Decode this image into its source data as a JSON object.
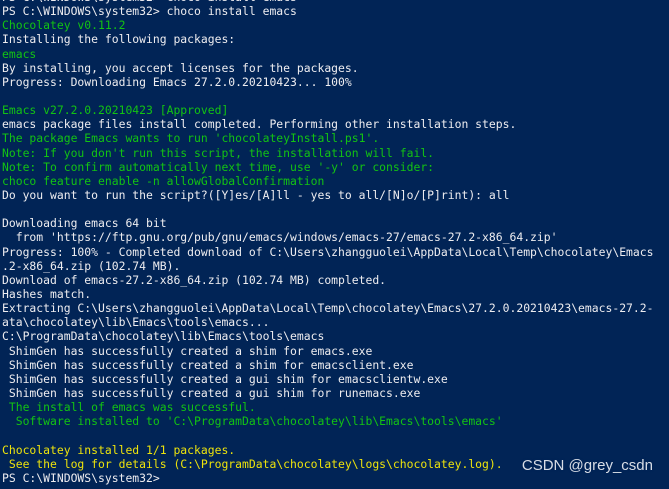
{
  "colors": {
    "background": "#012456",
    "default": "#eeedf0",
    "green": "#13c313",
    "yellow": "#ede30c",
    "highlight": "#f2f5ee"
  },
  "terminal": {
    "lines": [
      {
        "text": "PS C:\\WINDOWS\\system32> choco install emacs",
        "color": "default"
      },
      {
        "text": "PS C:\\WINDOWS\\system32> choco install emacs",
        "color": "default"
      },
      {
        "text": "Chocolatey v0.11.2",
        "color": "green"
      },
      {
        "text": "Installing the following packages:",
        "color": "default"
      },
      {
        "text": "emacs",
        "color": "green"
      },
      {
        "text": "By installing, you accept licenses for the packages.",
        "color": "default"
      },
      {
        "text": "Progress: Downloading Emacs 27.2.0.20210423... 100%",
        "color": "default"
      },
      {
        "text": "",
        "color": "default"
      },
      {
        "text": "Emacs v27.2.0.20210423 [Approved]",
        "color": "green"
      },
      {
        "text": "emacs package files install completed. Performing other installation steps.",
        "color": "default"
      },
      {
        "text": "The package Emacs wants to run 'chocolateyInstall.ps1'.",
        "color": "green"
      },
      {
        "text": "Note: If you don't run this script, the installation will fail.",
        "color": "green"
      },
      {
        "text": "Note: To confirm automatically next time, use '-y' or consider:",
        "color": "green"
      },
      {
        "text": "choco feature enable -n allowGlobalConfirmation",
        "color": "green"
      },
      {
        "text": "Do you want to run the script?([Y]es/[A]ll - yes to all/[N]o/[P]rint): all",
        "color": "default"
      },
      {
        "text": "",
        "color": "default"
      },
      {
        "text": "Downloading emacs 64 bit",
        "color": "default"
      },
      {
        "text": "  from 'https://ftp.gnu.org/pub/gnu/emacs/windows/emacs-27/emacs-27.2-x86_64.zip'",
        "color": "default"
      },
      {
        "text": "Progress: 100% - Completed download of C:\\Users\\zhangguolei\\AppData\\Local\\Temp\\chocolatey\\Emacs",
        "color": "default"
      },
      {
        "text": ".2-x86_64.zip (102.74 MB).",
        "color": "default"
      },
      {
        "text": "Download of emacs-27.2-x86_64.zip (102.74 MB) completed.",
        "color": "default"
      },
      {
        "text": "Hashes match.",
        "color": "default"
      },
      {
        "text": "Extracting C:\\Users\\zhangguolei\\AppData\\Local\\Temp\\chocolatey\\Emacs\\27.2.0.20210423\\emacs-27.2-",
        "color": "default"
      },
      {
        "text": "ata\\chocolatey\\lib\\Emacs\\tools\\emacs...",
        "color": "default"
      },
      {
        "text": "C:\\ProgramData\\chocolatey\\lib\\Emacs\\tools\\emacs",
        "color": "default"
      },
      {
        "text": " ShimGen has successfully created a shim for emacs.exe",
        "color": "default"
      },
      {
        "text": " ShimGen has successfully created a shim for emacsclient.exe",
        "color": "default"
      },
      {
        "text": " ShimGen has successfully created a gui shim for emacsclientw.exe",
        "color": "default"
      },
      {
        "text": " ShimGen has successfully created a gui shim for runemacs.exe",
        "color": "default"
      },
      {
        "text": " The install of emacs was successful.",
        "color": "green"
      },
      {
        "text": "  Software installed to 'C:\\ProgramData\\chocolatey\\lib\\Emacs\\tools\\emacs'",
        "color": "green"
      },
      {
        "text": "",
        "color": "default"
      },
      {
        "text": "Chocolatey installed 1/1 packages.",
        "color": "yellow"
      },
      {
        "text": " See the log for details (C:\\ProgramData\\chocolatey\\logs\\chocolatey.log).",
        "color": "yellow"
      },
      {
        "text": "PS C:\\WINDOWS\\system32>",
        "color": "default"
      }
    ]
  },
  "watermark": {
    "text": "CSDN @grey_csdn"
  }
}
